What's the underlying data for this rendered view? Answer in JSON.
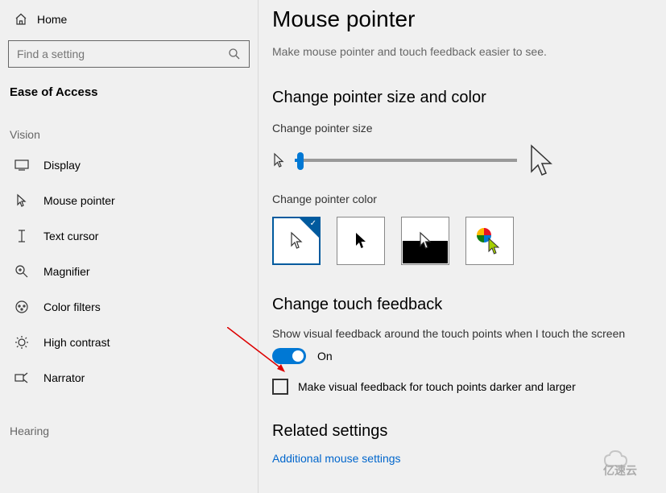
{
  "sidebar": {
    "home": "Home",
    "search_placeholder": "Find a setting",
    "category": "Ease of Access",
    "groups": [
      {
        "label": "Vision",
        "items": [
          {
            "icon": "display-icon",
            "label": "Display"
          },
          {
            "icon": "mouse-pointer-icon",
            "label": "Mouse pointer"
          },
          {
            "icon": "text-cursor-icon",
            "label": "Text cursor"
          },
          {
            "icon": "magnifier-icon",
            "label": "Magnifier"
          },
          {
            "icon": "color-filters-icon",
            "label": "Color filters"
          },
          {
            "icon": "high-contrast-icon",
            "label": "High contrast"
          },
          {
            "icon": "narrator-icon",
            "label": "Narrator"
          }
        ]
      },
      {
        "label": "Hearing",
        "items": []
      }
    ]
  },
  "main": {
    "title": "Mouse pointer",
    "subtitle": "Make mouse pointer and touch feedback easier to see.",
    "section1": {
      "heading": "Change pointer size and color",
      "size_label": "Change pointer size",
      "color_label": "Change pointer color",
      "color_options": [
        "white",
        "black",
        "inverted",
        "custom"
      ]
    },
    "section2": {
      "heading": "Change touch feedback",
      "toggle_label": "Show visual feedback around the touch points when I touch the screen",
      "toggle_state": "On",
      "checkbox_label": "Make visual feedback for touch points darker and larger"
    },
    "section3": {
      "heading": "Related settings",
      "link": "Additional mouse settings"
    }
  },
  "watermark": "亿速云"
}
